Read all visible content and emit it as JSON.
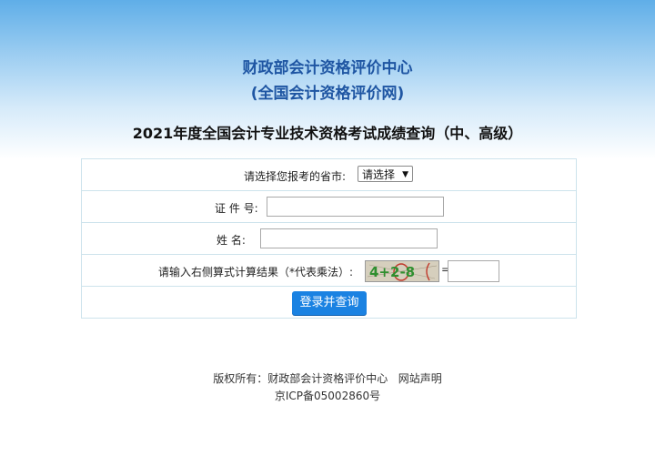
{
  "header": {
    "org_name": "财政部会计资格评价中心",
    "org_site": "(全国会计资格评价网)",
    "exam_title": "2021年度全国会计专业技术资格考试成绩查询（中、高级）"
  },
  "form": {
    "province_label": "请选择您报考的省市:",
    "province_value": "请选择",
    "id_label": "证 件 号:",
    "id_value": "",
    "name_label": "姓 名:",
    "name_value": "",
    "captcha_label": "请输入右侧算式计算结果（*代表乘法）:",
    "captcha_expression": "4+2-8",
    "equals": "=",
    "captcha_value": "",
    "submit_label": "登录并查询"
  },
  "footer": {
    "copyright": "版权所有：财政部会计资格评价中心",
    "statement_link": "网站声明",
    "icp": "京ICP备05002860号"
  }
}
